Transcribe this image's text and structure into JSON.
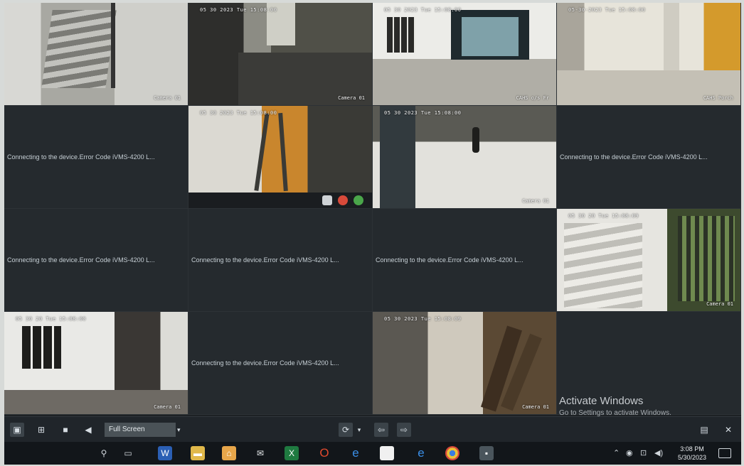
{
  "grid": {
    "tiles": [
      {
        "type": "feed",
        "scene": "stairs",
        "time": "",
        "cam": "Camera 01"
      },
      {
        "type": "feed",
        "scene": "corr",
        "time": "05 30 2023  Tue 15:08:00",
        "cam": "Camera 01"
      },
      {
        "type": "feed",
        "scene": "lobby",
        "time": "05 30 2023  Tue 15:08:00",
        "cam": "CAHS o/s Fr"
      },
      {
        "type": "feed",
        "scene": "lobby2",
        "time": "05-30-2023 Tue 15:08:00",
        "cam": "CAHS Porch"
      },
      {
        "type": "error",
        "text": "Connecting to the device.Error Code iVMS-4200 L..."
      },
      {
        "type": "feed",
        "scene": "hall",
        "time": "05 30 2023 Tue 15:08:00",
        "cam": ""
      },
      {
        "type": "feed",
        "scene": "floor",
        "time": "05 30 2023 Tue 15:08:00",
        "cam": "Camera 01"
      },
      {
        "type": "error",
        "text": "Connecting to the device.Error Code iVMS-4200 L..."
      },
      {
        "type": "error",
        "text": "Connecting to the device.Error Code iVMS-4200 L..."
      },
      {
        "type": "error",
        "text": "Connecting to the device.Error Code iVMS-4200 L..."
      },
      {
        "type": "error",
        "text": "Connecting to the device.Error Code iVMS-4200 L..."
      },
      {
        "type": "feed",
        "scene": "stairs2",
        "time": "05 30 20  Tue 15:08:09",
        "cam": "Camera 01"
      },
      {
        "type": "feed",
        "scene": "room",
        "time": "05 30 20  Tue 15:08:00",
        "cam": "Camera 01"
      },
      {
        "type": "error",
        "text": "Connecting to the device.Error Code iVMS-4200 L..."
      },
      {
        "type": "feed",
        "scene": "wood",
        "time": "05 30 2023 Tue 15:08:09",
        "cam": "Camera 01"
      },
      {
        "type": "empty"
      }
    ]
  },
  "watermark": {
    "title": "Activate Windows",
    "subtitle": "Go to Settings to activate Windows."
  },
  "controls": {
    "view_select": "Full Screen"
  },
  "taskbar": {
    "time": "3:08 PM",
    "date": "5/30/2023"
  },
  "colors": {
    "accent_red": "#b44a3f",
    "taskbar_bg": "#12161a",
    "control_bar_bg": "#20252a"
  }
}
